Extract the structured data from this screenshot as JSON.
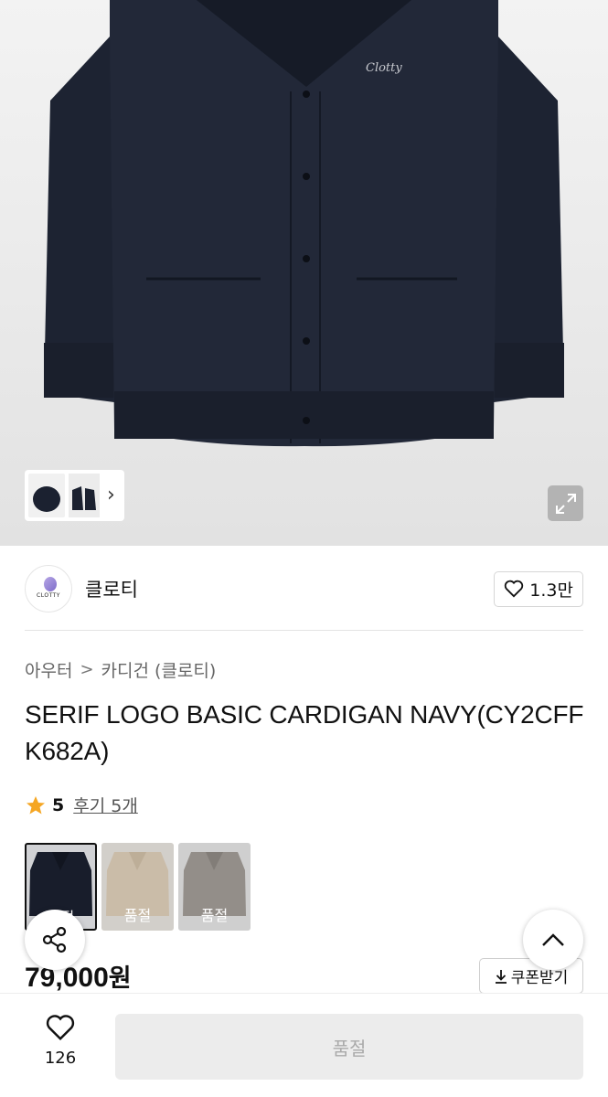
{
  "hero": {
    "print_text": "Clotty",
    "thumb_next": "›"
  },
  "brand": {
    "logo_text": "CLOTTY",
    "name": "클로티",
    "likes": "1.3만"
  },
  "breadcrumb": {
    "category": "아우터",
    "separator": ">",
    "subcategory": "카디건 (클로티)"
  },
  "product": {
    "title": "SERIF LOGO BASIC CARDIGAN NAVY(CY2CFFK682A)",
    "rating": "5",
    "reviews": "후기 5개",
    "price_number": "79,000",
    "price_unit": "원"
  },
  "colors": [
    {
      "label": "품절",
      "color": "#1c2231",
      "selected": true
    },
    {
      "label": "품절",
      "color": "#e6d6c0",
      "selected": false
    },
    {
      "label": "품절",
      "color": "#a8a29c",
      "selected": false
    }
  ],
  "buttons": {
    "coupon": "쿠폰받기",
    "wish_count": "126",
    "buy": "품절"
  },
  "icons": {
    "expand": "expand-icon",
    "heart": "heart-icon",
    "star": "star-icon",
    "share": "share-icon",
    "scroll_top": "chevron-up-icon",
    "download": "download-icon"
  },
  "accent_colors": {
    "star": "#f5a623",
    "cardigan": "#1b2130",
    "disabled_button": "#ececec"
  }
}
